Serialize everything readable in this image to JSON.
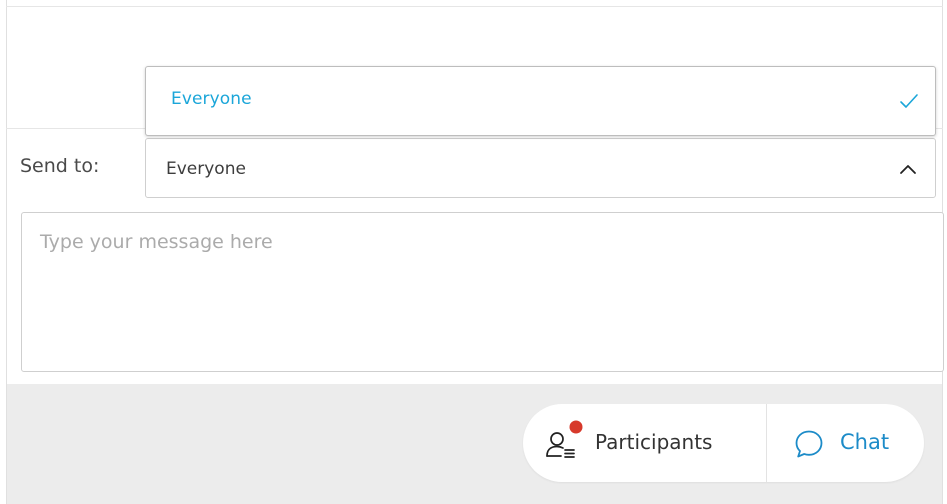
{
  "dropdown": {
    "options": [
      {
        "label": "Everyone",
        "selected": true
      }
    ],
    "accent_color": "#1ba6d9"
  },
  "send_to": {
    "label": "Send to:",
    "value": "Everyone"
  },
  "message": {
    "placeholder": "Type your message here",
    "value": ""
  },
  "footer": {
    "participants": {
      "label": "Participants",
      "icon": "participants-icon",
      "has_notification": true,
      "notification_color": "#d7392b"
    },
    "chat": {
      "label": "Chat",
      "icon": "chat-bubble-icon",
      "color": "#1c8bc8"
    }
  }
}
